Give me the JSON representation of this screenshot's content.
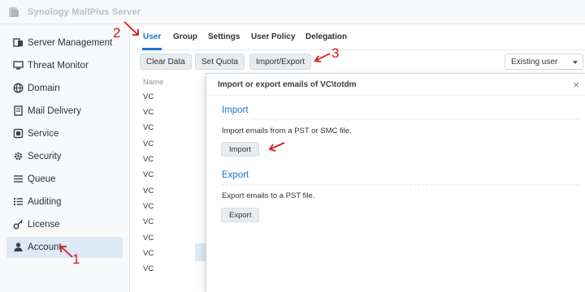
{
  "app": {
    "title": "Synology MailPlus Server"
  },
  "sidebar": {
    "items": [
      {
        "label": "Server Management",
        "icon": "server-icon"
      },
      {
        "label": "Threat Monitor",
        "icon": "monitor-icon"
      },
      {
        "label": "Domain",
        "icon": "globe-icon"
      },
      {
        "label": "Mail Delivery",
        "icon": "mail-delivery-icon"
      },
      {
        "label": "Service",
        "icon": "service-icon"
      },
      {
        "label": "Security",
        "icon": "gear-icon"
      },
      {
        "label": "Queue",
        "icon": "list-icon"
      },
      {
        "label": "Auditing",
        "icon": "list-icon"
      },
      {
        "label": "License",
        "icon": "key-icon"
      },
      {
        "label": "Account",
        "icon": "user-icon",
        "active": true
      }
    ]
  },
  "tabs": [
    {
      "label": "User",
      "active": true
    },
    {
      "label": "Group"
    },
    {
      "label": "Settings"
    },
    {
      "label": "User Policy"
    },
    {
      "label": "Delegation"
    }
  ],
  "toolbar": {
    "clear_data": "Clear Data",
    "set_quota": "Set Quota",
    "import_export": "Import/Export",
    "filter_value": "Existing user"
  },
  "table": {
    "column_name": "Name",
    "rows": [
      "VC",
      "VC",
      "VC",
      "VC",
      "VC",
      "VC",
      "VC",
      "VC",
      "VC",
      "VC",
      "VC",
      "VC"
    ]
  },
  "modal": {
    "title": "Import or export emails of VC\\totdm",
    "close": "×",
    "import": {
      "heading": "Import",
      "description": "Import emails from a PST or SMC file.",
      "button": "Import"
    },
    "export": {
      "heading": "Export",
      "description": "Export emails to a PST file.",
      "button": "Export"
    }
  },
  "annotations": {
    "step1": "1",
    "step2": "2",
    "step3": "3"
  },
  "colors": {
    "accent": "#1a73c9",
    "annotation": "#d7191f",
    "active_bg": "#dde9f5"
  }
}
